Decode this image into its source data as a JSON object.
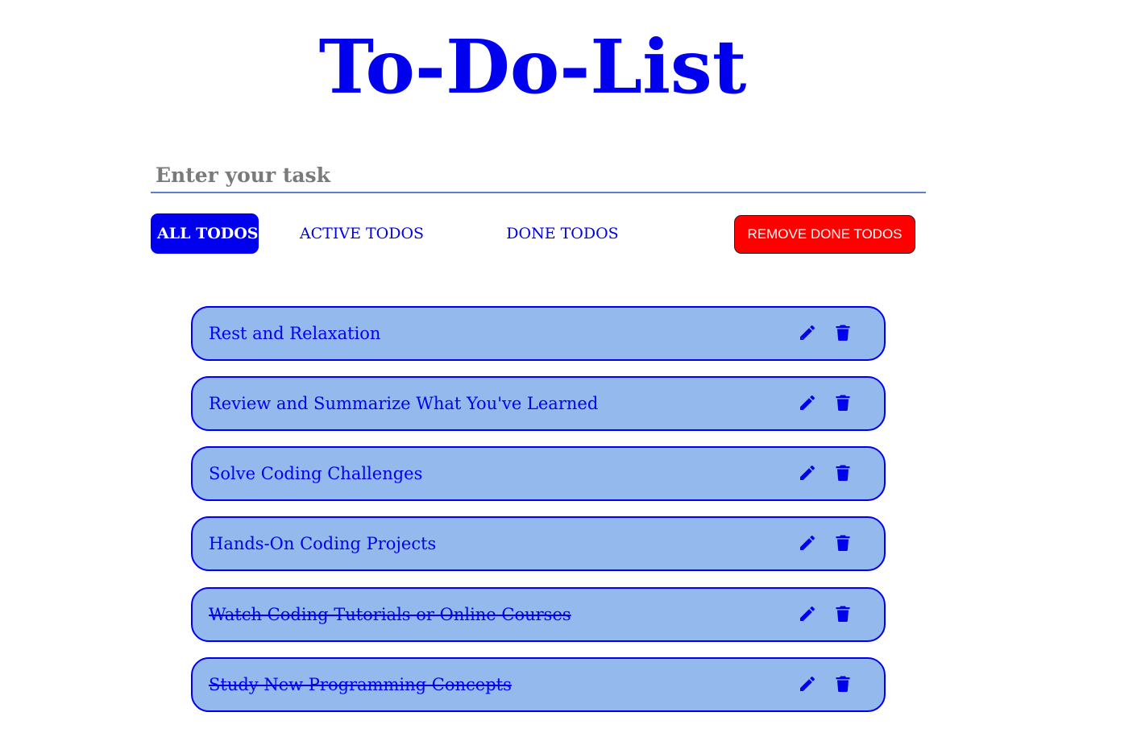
{
  "header": {
    "title": "To-Do-List"
  },
  "input": {
    "placeholder": "Enter your task",
    "value": ""
  },
  "filters": {
    "all": "ALL TODOS",
    "active": "ACTIVE TODOS",
    "done": "DONE TODOS",
    "selected": "all"
  },
  "actions": {
    "remove_done": "REMOVE DONE TODOS"
  },
  "todos": [
    {
      "text": "Rest and Relaxation",
      "done": false
    },
    {
      "text": "Review and Summarize What You've Learned",
      "done": false
    },
    {
      "text": "Solve Coding Challenges",
      "done": false
    },
    {
      "text": "Hands-On Coding Projects",
      "done": false
    },
    {
      "text": "Watch Coding Tutorials or Online Courses",
      "done": true
    },
    {
      "text": "Study New Programming Concepts",
      "done": true
    }
  ],
  "icons": {
    "edit": "pencil-icon",
    "delete": "trash-icon"
  },
  "colors": {
    "primary": "#0000ee",
    "item_bg": "#93b9ed",
    "danger": "#ff0000",
    "placeholder": "#7a7a7a"
  }
}
